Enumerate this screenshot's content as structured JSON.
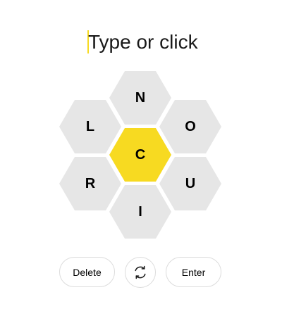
{
  "word_input": {
    "placeholder": "Type or click"
  },
  "hive": {
    "center_letter": "C",
    "outer_letters": {
      "top": "N",
      "upper_left": "L",
      "upper_right": "O",
      "lower_left": "R",
      "lower_right": "U",
      "bottom": "I"
    },
    "colors": {
      "center_fill": "#f7da21",
      "outer_fill": "#e6e6e6"
    }
  },
  "controls": {
    "delete_label": "Delete",
    "shuffle_icon": "shuffle-icon",
    "enter_label": "Enter"
  }
}
